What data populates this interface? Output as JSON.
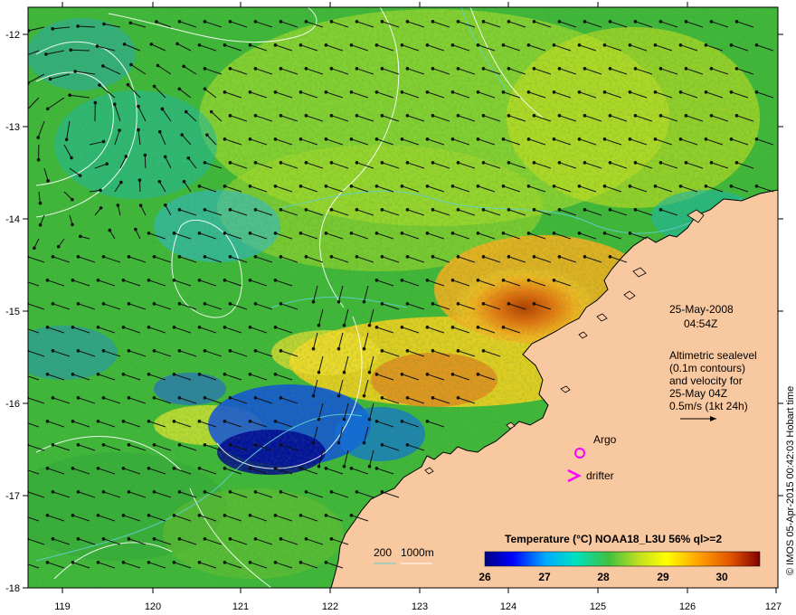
{
  "map": {
    "lon_ticks": [
      "119",
      "120",
      "121",
      "122",
      "123",
      "124",
      "125",
      "126",
      "127"
    ],
    "lat_ticks": [
      "-12",
      "-13",
      "-14",
      "-15",
      "-16",
      "-17",
      "-18"
    ],
    "date_label": "25-May-2008",
    "time_label": "04:54Z",
    "altimetry_lines": [
      "Altimetric sealevel",
      "(0.1m contours)",
      "and velocity for",
      "25-May 04Z",
      "0.5m/s (1kt 24h)"
    ],
    "argo_label": "Argo",
    "drifter_label": "drifter",
    "depth_label_200": "200",
    "depth_label_1000": "1000m",
    "colorbar_title": "Temperature (°C) NOAA18_L3U 56% ql>=2",
    "colorbar_ticks": [
      "26",
      "27",
      "28",
      "29",
      "30"
    ],
    "credit": "© IMOS 05-Apr-2015 00:42:03 Hobart time"
  },
  "colors": {
    "ocean_base": "#3fb83a",
    "land": "#f8c8a0",
    "argo_marker": "#ff00ff",
    "drifter_marker": "#ff00ff",
    "contour": "#ffffff",
    "bathymetry": "#5fd0d0",
    "arrow": "#111111",
    "colorbar": [
      "#000080",
      "#0000ff",
      "#00aaff",
      "#00e0c0",
      "#40c040",
      "#c0e020",
      "#ffff00",
      "#ffa000",
      "#e05000",
      "#800000"
    ]
  }
}
